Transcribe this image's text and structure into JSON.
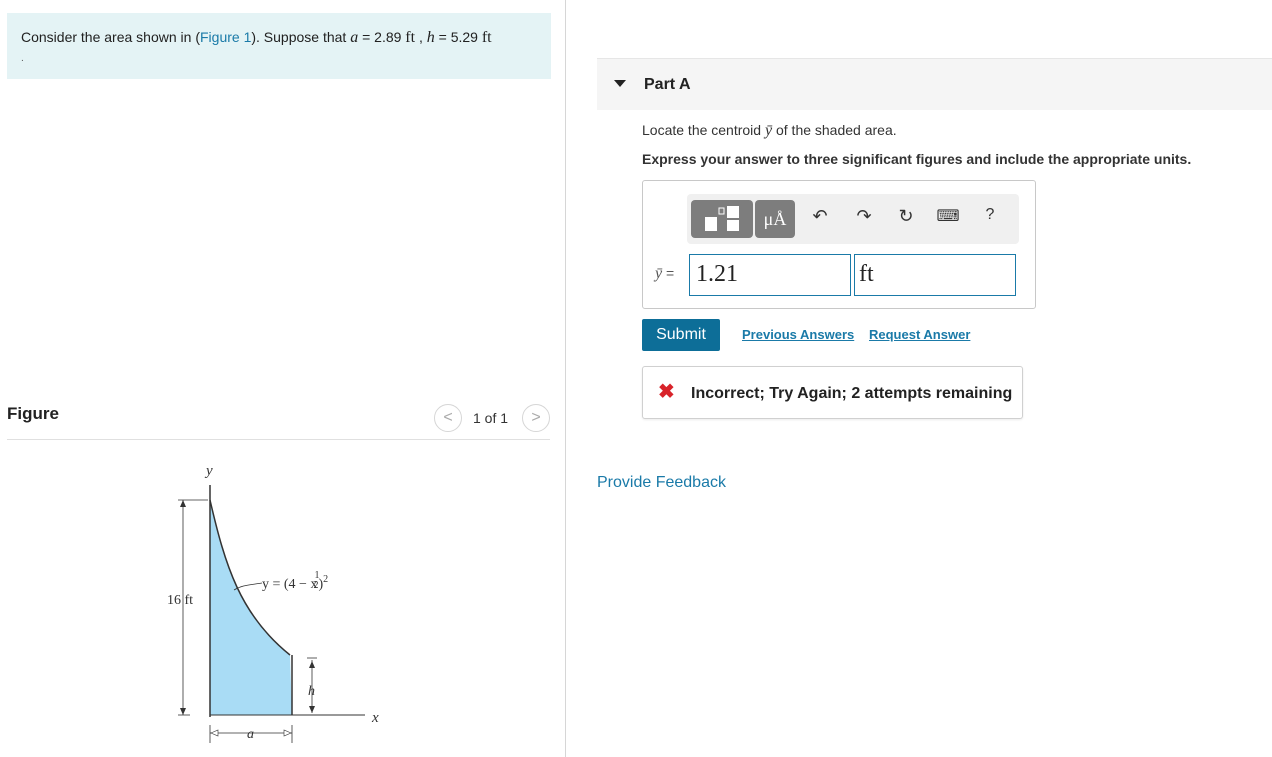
{
  "problem": {
    "text_before_link": "Consider the area shown in (",
    "link": "Figure 1",
    "text_after_link": "). Suppose that ",
    "a_var": "a",
    "a_eq": " = 2.89 ",
    "a_unit": "ft",
    "comma": " , ",
    "h_var": "h",
    "h_eq": " = 5.29 ",
    "h_unit": "ft",
    "trailing": "."
  },
  "figure": {
    "title": "Figure",
    "prev": "<",
    "next": ">",
    "page_count": "1 of 1",
    "labels": {
      "y_axis": "y",
      "x_axis": "x",
      "height": "16 ft",
      "equation_main": "y = (4 − x",
      "equation_exp": "2",
      "equation_frac_num": "1",
      "equation_close": ")",
      "equation_sq": "2",
      "h": "h",
      "a": "a"
    },
    "colors": {
      "fill": "#a9dcf5",
      "stroke": "#333333"
    }
  },
  "part": {
    "title": "Part A",
    "question_before": "Locate the centroid ",
    "question_var": "ȳ",
    "question_after": " of the shaded area.",
    "instruction": "Express your answer to three significant figures and include the appropriate units."
  },
  "answer": {
    "toolbar": {
      "template_icon": "templates-icon",
      "units_label": "μÅ",
      "undo": "↶",
      "redo": "↷",
      "reset": "↻",
      "keyboard": "⌨",
      "help": "?"
    },
    "var_label": "ȳ",
    "equals": " =",
    "value": "1.21",
    "unit": "ft"
  },
  "actions": {
    "submit": "Submit",
    "previous_answers": "Previous Answers",
    "request_answer": "Request Answer"
  },
  "feedback": {
    "icon": "✖",
    "text": "Incorrect; Try Again; 2 attempts remaining"
  },
  "provide_feedback": "Provide Feedback",
  "colors": {
    "accent": "#0d6e98",
    "link": "#1a7aa8",
    "error": "#d8232a",
    "problem_bg": "#e4f3f5"
  }
}
